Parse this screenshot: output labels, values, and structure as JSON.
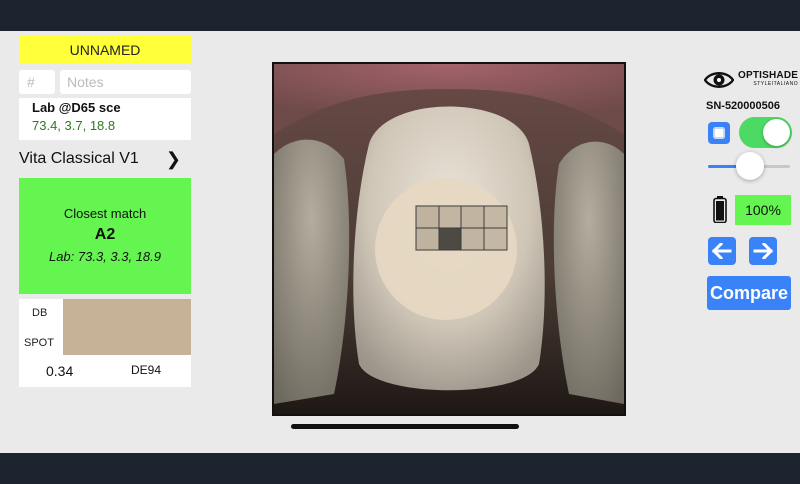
{
  "left_panel": {
    "shade_name": "UNNAMED",
    "number_placeholder": "#",
    "notes_placeholder": "Notes",
    "lab_title": "Lab @D65 sce",
    "lab_values": "73.4, 3.7, 18.8",
    "library_name": "Vita Classical V1",
    "closest_match_label": "Closest match",
    "closest_match_shade": "A2",
    "closest_match_lab": "Lab: 73.3, 3.3, 18.9",
    "db_label": "DB",
    "spot_label": "SPOT",
    "delta_e_value": "0.34",
    "delta_e_label": "DE94"
  },
  "right_panel": {
    "brand_name": "OPTISHADE",
    "brand_sub": "STYLEITALIANO",
    "serial": "SN-520000506",
    "toggle_on": true,
    "slider_level": 0.5,
    "battery_percent": "100%",
    "compare_label": "Compare"
  },
  "colors": {
    "name_bar": "#ffff3a",
    "match_green": "#64f550",
    "lab_text_green": "#2d7a1e",
    "accent_blue": "#3a82f7",
    "toggle_green": "#4cd964",
    "shade_swatch": "#c6b397"
  }
}
